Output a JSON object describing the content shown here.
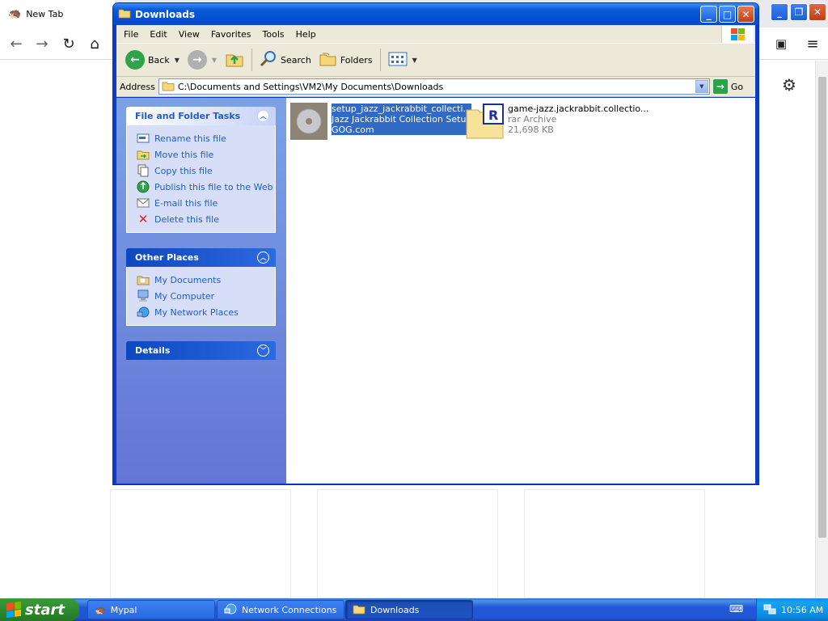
{
  "browser": {
    "tab_title": "New Tab"
  },
  "window": {
    "title": "Downloads"
  },
  "menu": [
    "File",
    "Edit",
    "View",
    "Favorites",
    "Tools",
    "Help"
  ],
  "toolbar": {
    "back_label": "Back",
    "search_label": "Search",
    "folders_label": "Folders"
  },
  "address": {
    "label": "Address",
    "path": "C:\\Documents and Settings\\VM2\\My Documents\\Downloads",
    "go_label": "Go"
  },
  "file_tasks": {
    "title": "File and Folder Tasks",
    "items": [
      {
        "label": "Rename this file",
        "icon": "rename-icon"
      },
      {
        "label": "Move this file",
        "icon": "move-icon"
      },
      {
        "label": "Copy this file",
        "icon": "copy-icon"
      },
      {
        "label": "Publish this file to the Web",
        "icon": "globe-icon"
      },
      {
        "label": "E-mail this file",
        "icon": "email-icon"
      },
      {
        "label": "Delete this file",
        "icon": "delete-icon"
      }
    ]
  },
  "other_places": {
    "title": "Other Places",
    "items": [
      {
        "label": "My Documents",
        "icon": "documents-folder-icon"
      },
      {
        "label": "My Computer",
        "icon": "computer-icon"
      },
      {
        "label": "My Network Places",
        "icon": "network-icon"
      }
    ]
  },
  "details": {
    "title": "Details"
  },
  "files": [
    {
      "name": "setup_jazz_jackrabbit_collecti...",
      "line2": "Jazz Jackrabbit Collection Setup",
      "line3": "GOG.com",
      "icon": "setup-cd-icon",
      "selected": true
    },
    {
      "name": "game-jazz.jackrabbit.collectio...",
      "line2": "rar Archive",
      "line3": "21,698 KB",
      "icon": "rar-archive-icon",
      "selected": false
    }
  ],
  "taskbar": {
    "start_label": "start",
    "buttons": [
      {
        "label": "Mypal",
        "icon": "mypal-icon"
      },
      {
        "label": "Network Connections",
        "icon": "network-connections-icon"
      },
      {
        "label": "Downloads",
        "icon": "folder-icon"
      }
    ],
    "clock": "10:56 AM"
  },
  "colors": {
    "xp_blue": "#0a3cc8",
    "selection": "#316ac5",
    "task_link": "#215dc6",
    "start_green": "#2e8a2e"
  }
}
